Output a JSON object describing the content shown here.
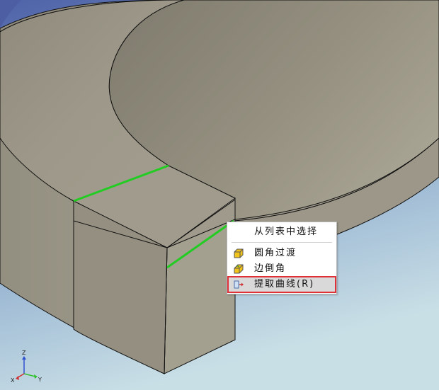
{
  "context_menu": {
    "header": "从列表中选择",
    "items": [
      {
        "label": "圆角过渡",
        "icon": "fillet-icon"
      },
      {
        "label": "边倒角",
        "icon": "chamfer-icon"
      },
      {
        "label": "提取曲线(R)",
        "icon": "extract-curve-icon",
        "highlighted": true
      }
    ]
  },
  "axes": {
    "z": "Z",
    "x": "X",
    "y": "Y"
  },
  "colors": {
    "background_top": "#5a6fb0",
    "background_bottom": "#c6dce6",
    "part_face": "#9a9688",
    "edge_highlight": "#22cc22",
    "menu_highlight_border": "#e0303a"
  }
}
